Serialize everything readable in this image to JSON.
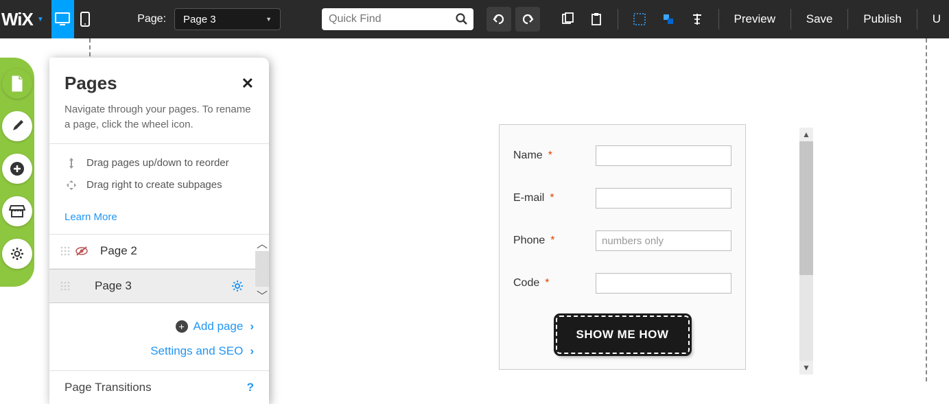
{
  "toolbar": {
    "logo": "WiX",
    "page_label": "Page:",
    "page_selected": "Page 3",
    "search_placeholder": "Quick Find",
    "preview": "Preview",
    "save": "Save",
    "publish": "Publish",
    "upgrade": "U"
  },
  "panel": {
    "title": "Pages",
    "desc": "Navigate through your pages. To rename a page, click the wheel icon.",
    "hint1": "Drag pages up/down to reorder",
    "hint2": "Drag right to create subpages",
    "learn_more": "Learn More",
    "pages": [
      {
        "name": "Page 2",
        "hidden": true,
        "selected": false
      },
      {
        "name": "Page 3",
        "hidden": false,
        "selected": true
      }
    ],
    "add_page": "Add page",
    "settings_seo": "Settings and SEO",
    "transitions": "Page Transitions"
  },
  "form": {
    "fields": [
      {
        "label": "Name",
        "placeholder": ""
      },
      {
        "label": "E-mail",
        "placeholder": ""
      },
      {
        "label": "Phone",
        "placeholder": "numbers only"
      },
      {
        "label": "Code",
        "placeholder": ""
      }
    ],
    "submit": "SHOW ME HOW"
  }
}
